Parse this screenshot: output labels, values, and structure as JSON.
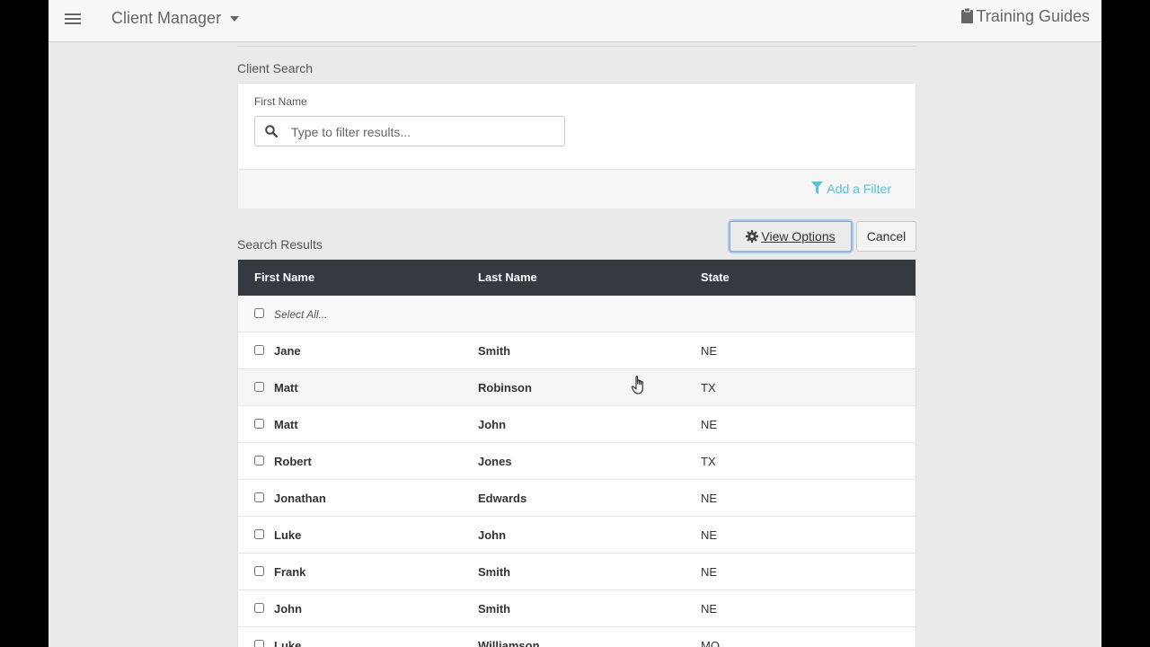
{
  "header": {
    "app_title": "Client Manager",
    "guides_label": "Training Guides"
  },
  "client_search": {
    "section_label": "Client Search",
    "first_name_label": "First Name",
    "search_placeholder": "Type to filter results...",
    "search_value": "",
    "add_filter_label": "Add a Filter"
  },
  "results": {
    "section_label": "Search Results",
    "view_options_label": "View Options",
    "cancel_label": "Cancel",
    "select_all_label": "Select All...",
    "columns": [
      "First Name",
      "Last Name",
      "State"
    ],
    "rows": [
      {
        "first": "Jane",
        "last": "Smith",
        "state": "NE"
      },
      {
        "first": "Matt",
        "last": "Robinson",
        "state": "TX"
      },
      {
        "first": "Matt",
        "last": "John",
        "state": "NE"
      },
      {
        "first": "Robert",
        "last": "Jones",
        "state": "TX"
      },
      {
        "first": "Jonathan",
        "last": "Edwards",
        "state": "NE"
      },
      {
        "first": "Luke",
        "last": "John",
        "state": "NE"
      },
      {
        "first": "Frank",
        "last": "Smith",
        "state": "NE"
      },
      {
        "first": "John",
        "last": "Smith",
        "state": "NE"
      },
      {
        "first": "Luke",
        "last": "Williamson",
        "state": "MO"
      }
    ]
  },
  "colors": {
    "table_header_bg": "#343a40",
    "accent": "#5bc0de",
    "focus_ring": "#a9c6e8"
  },
  "icons": [
    "menu-icon",
    "caret-down-icon",
    "clipboard-icon",
    "search-icon",
    "filter-icon",
    "gear-icon",
    "hand-cursor-icon"
  ]
}
